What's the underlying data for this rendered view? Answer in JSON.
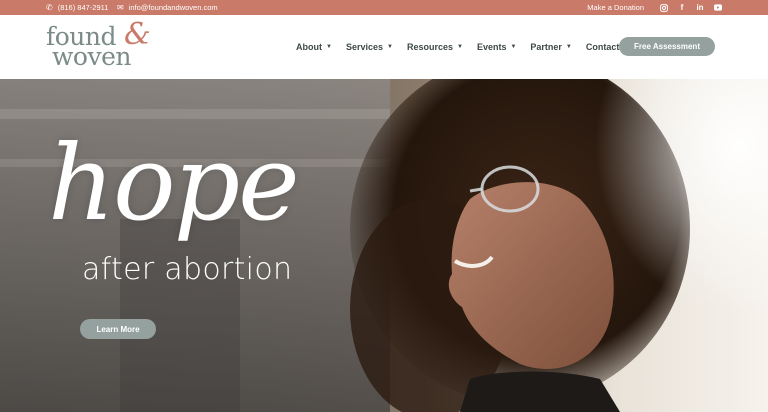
{
  "topbar": {
    "phone": "(816) 847-2911",
    "email": "info@foundandwoven.com",
    "donate": "Make a Donation",
    "social_icons": [
      "instagram-icon",
      "facebook-icon",
      "linkedin-icon",
      "youtube-icon"
    ],
    "background": "#c97a68"
  },
  "logo": {
    "line1": "found",
    "line2": "woven",
    "ampersand": "&"
  },
  "nav": {
    "items": [
      {
        "label": "About",
        "dropdown": true
      },
      {
        "label": "Services",
        "dropdown": true
      },
      {
        "label": "Resources",
        "dropdown": true
      },
      {
        "label": "Events",
        "dropdown": true
      },
      {
        "label": "Partner",
        "dropdown": true
      },
      {
        "label": "Contact",
        "dropdown": false
      }
    ],
    "cta": "Free Assessment"
  },
  "hero": {
    "headline": "hope",
    "subheadline": "after abortion",
    "button": "Learn More"
  },
  "colors": {
    "accent": "#c97a68",
    "button": "#95a19e",
    "logo_text": "#7a8b88",
    "nav_text": "#3e4a48"
  }
}
